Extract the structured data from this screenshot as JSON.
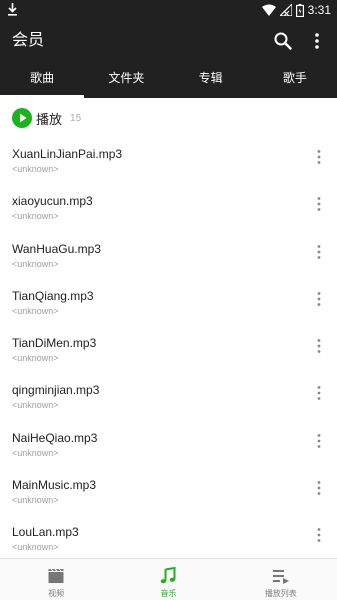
{
  "status_bar": {
    "time": "3:31",
    "icons": [
      "download-icon",
      "wifi-icon",
      "signal-icon",
      "battery-icon"
    ]
  },
  "app_bar": {
    "title": "会员",
    "actions": [
      "search-icon",
      "more-vert-icon"
    ]
  },
  "tabs": [
    {
      "label": "歌曲",
      "active": true
    },
    {
      "label": "文件夹",
      "active": false
    },
    {
      "label": "专辑",
      "active": false
    },
    {
      "label": "歌手",
      "active": false
    }
  ],
  "play_all": {
    "label": "播放",
    "count": "15"
  },
  "songs": [
    {
      "title": "XuanLinJianPai.mp3",
      "artist": "<unknown>"
    },
    {
      "title": "xiaoyucun.mp3",
      "artist": "<unknown>"
    },
    {
      "title": "WanHuaGu.mp3",
      "artist": "<unknown>"
    },
    {
      "title": "TianQiang.mp3",
      "artist": "<unknown>"
    },
    {
      "title": "TianDiMen.mp3",
      "artist": "<unknown>"
    },
    {
      "title": "qingminjian.mp3",
      "artist": "<unknown>"
    },
    {
      "title": "NaiHeQiao.mp3",
      "artist": "<unknown>"
    },
    {
      "title": "MainMusic.mp3",
      "artist": "<unknown>"
    },
    {
      "title": "LouLan.mp3",
      "artist": "<unknown>"
    }
  ],
  "bottom_nav": [
    {
      "label": "视频",
      "icon": "video-icon",
      "active": false
    },
    {
      "label": "音乐",
      "icon": "music-note-icon",
      "active": true
    },
    {
      "label": "播放列表",
      "icon": "playlist-icon",
      "active": false
    }
  ],
  "colors": {
    "header_bg": "#212121",
    "accent": "#1bb21b",
    "text_primary": "#212121",
    "text_secondary": "#9e9e9e"
  }
}
